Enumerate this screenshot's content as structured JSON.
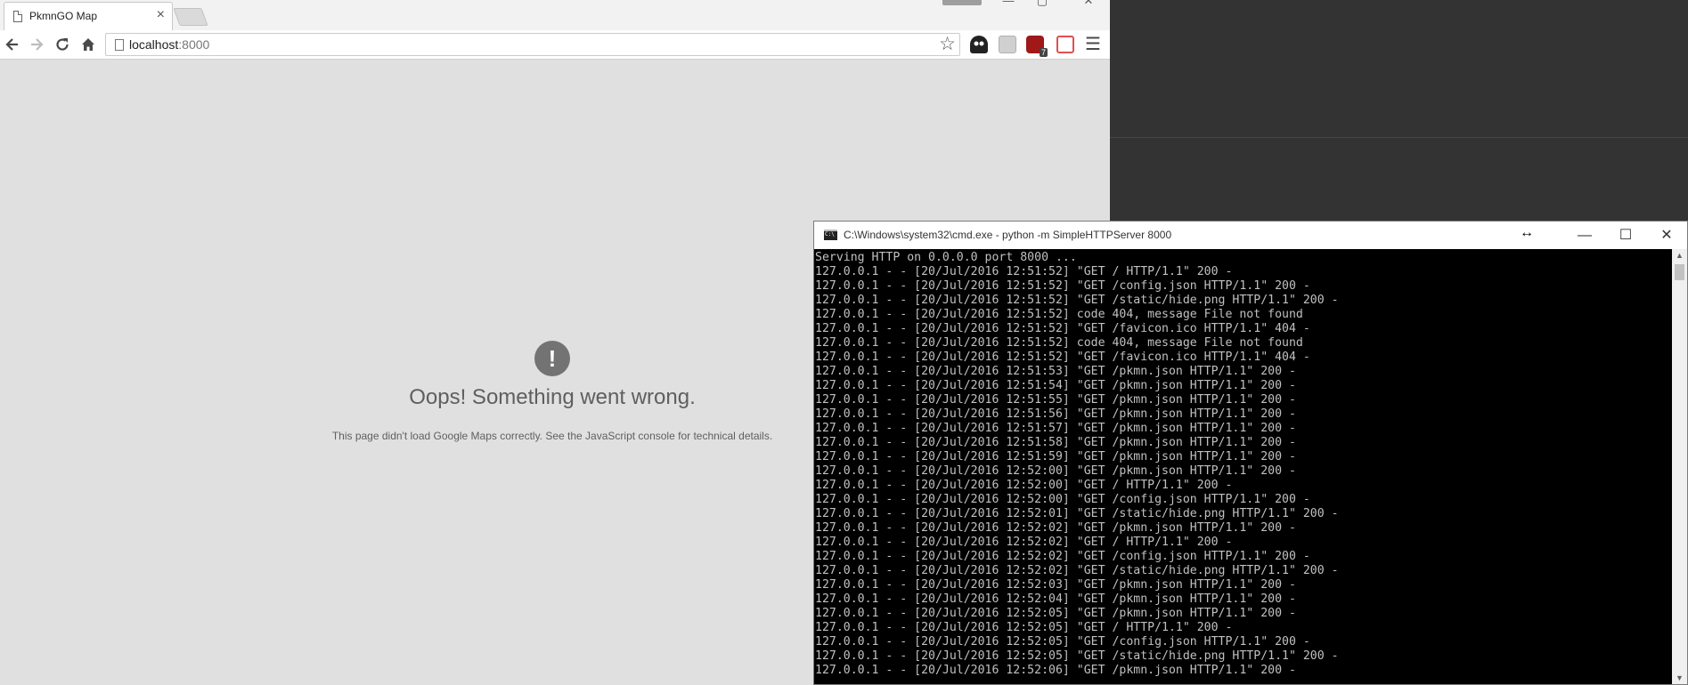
{
  "browser": {
    "tab_title": "PkmnGO Map",
    "tab_close": "×",
    "url_host": "localhost",
    "url_port": ":8000",
    "error_icon": "!",
    "error_title": "Oops! Something went wrong.",
    "error_detail": "This page didn't load Google Maps correctly. See the JavaScript console for technical details.",
    "extension_icons": [
      "ghostery-icon",
      "extension-icon",
      "ublock-icon",
      "pdf-icon"
    ],
    "ublock_badge": "7"
  },
  "console": {
    "title": "C:\\Windows\\system32\\cmd.exe - python  -m SimpleHTTPServer 8000",
    "lines": [
      "Serving HTTP on 0.0.0.0 port 8000 ...",
      "127.0.0.1 - - [20/Jul/2016 12:51:52] \"GET / HTTP/1.1\" 200 -",
      "127.0.0.1 - - [20/Jul/2016 12:51:52] \"GET /config.json HTTP/1.1\" 200 -",
      "127.0.0.1 - - [20/Jul/2016 12:51:52] \"GET /static/hide.png HTTP/1.1\" 200 -",
      "127.0.0.1 - - [20/Jul/2016 12:51:52] code 404, message File not found",
      "127.0.0.1 - - [20/Jul/2016 12:51:52] \"GET /favicon.ico HTTP/1.1\" 404 -",
      "127.0.0.1 - - [20/Jul/2016 12:51:52] code 404, message File not found",
      "127.0.0.1 - - [20/Jul/2016 12:51:52] \"GET /favicon.ico HTTP/1.1\" 404 -",
      "127.0.0.1 - - [20/Jul/2016 12:51:53] \"GET /pkmn.json HTTP/1.1\" 200 -",
      "127.0.0.1 - - [20/Jul/2016 12:51:54] \"GET /pkmn.json HTTP/1.1\" 200 -",
      "127.0.0.1 - - [20/Jul/2016 12:51:55] \"GET /pkmn.json HTTP/1.1\" 200 -",
      "127.0.0.1 - - [20/Jul/2016 12:51:56] \"GET /pkmn.json HTTP/1.1\" 200 -",
      "127.0.0.1 - - [20/Jul/2016 12:51:57] \"GET /pkmn.json HTTP/1.1\" 200 -",
      "127.0.0.1 - - [20/Jul/2016 12:51:58] \"GET /pkmn.json HTTP/1.1\" 200 -",
      "127.0.0.1 - - [20/Jul/2016 12:51:59] \"GET /pkmn.json HTTP/1.1\" 200 -",
      "127.0.0.1 - - [20/Jul/2016 12:52:00] \"GET /pkmn.json HTTP/1.1\" 200 -",
      "127.0.0.1 - - [20/Jul/2016 12:52:00] \"GET / HTTP/1.1\" 200 -",
      "127.0.0.1 - - [20/Jul/2016 12:52:00] \"GET /config.json HTTP/1.1\" 200 -",
      "127.0.0.1 - - [20/Jul/2016 12:52:01] \"GET /static/hide.png HTTP/1.1\" 200 -",
      "127.0.0.1 - - [20/Jul/2016 12:52:02] \"GET /pkmn.json HTTP/1.1\" 200 -",
      "127.0.0.1 - - [20/Jul/2016 12:52:02] \"GET / HTTP/1.1\" 200 -",
      "127.0.0.1 - - [20/Jul/2016 12:52:02] \"GET /config.json HTTP/1.1\" 200 -",
      "127.0.0.1 - - [20/Jul/2016 12:52:02] \"GET /static/hide.png HTTP/1.1\" 200 -",
      "127.0.0.1 - - [20/Jul/2016 12:52:03] \"GET /pkmn.json HTTP/1.1\" 200 -",
      "127.0.0.1 - - [20/Jul/2016 12:52:04] \"GET /pkmn.json HTTP/1.1\" 200 -",
      "127.0.0.1 - - [20/Jul/2016 12:52:05] \"GET /pkmn.json HTTP/1.1\" 200 -",
      "127.0.0.1 - - [20/Jul/2016 12:52:05] \"GET / HTTP/1.1\" 200 -",
      "127.0.0.1 - - [20/Jul/2016 12:52:05] \"GET /config.json HTTP/1.1\" 200 -",
      "127.0.0.1 - - [20/Jul/2016 12:52:05] \"GET /static/hide.png HTTP/1.1\" 200 -",
      "127.0.0.1 - - [20/Jul/2016 12:52:06] \"GET /pkmn.json HTTP/1.1\" 200 -"
    ]
  },
  "colors": {
    "console_bg": "#000000",
    "console_text": "#c0c0c0",
    "page_bg": "#e0e0e0",
    "error_icon_bg": "#737373"
  }
}
